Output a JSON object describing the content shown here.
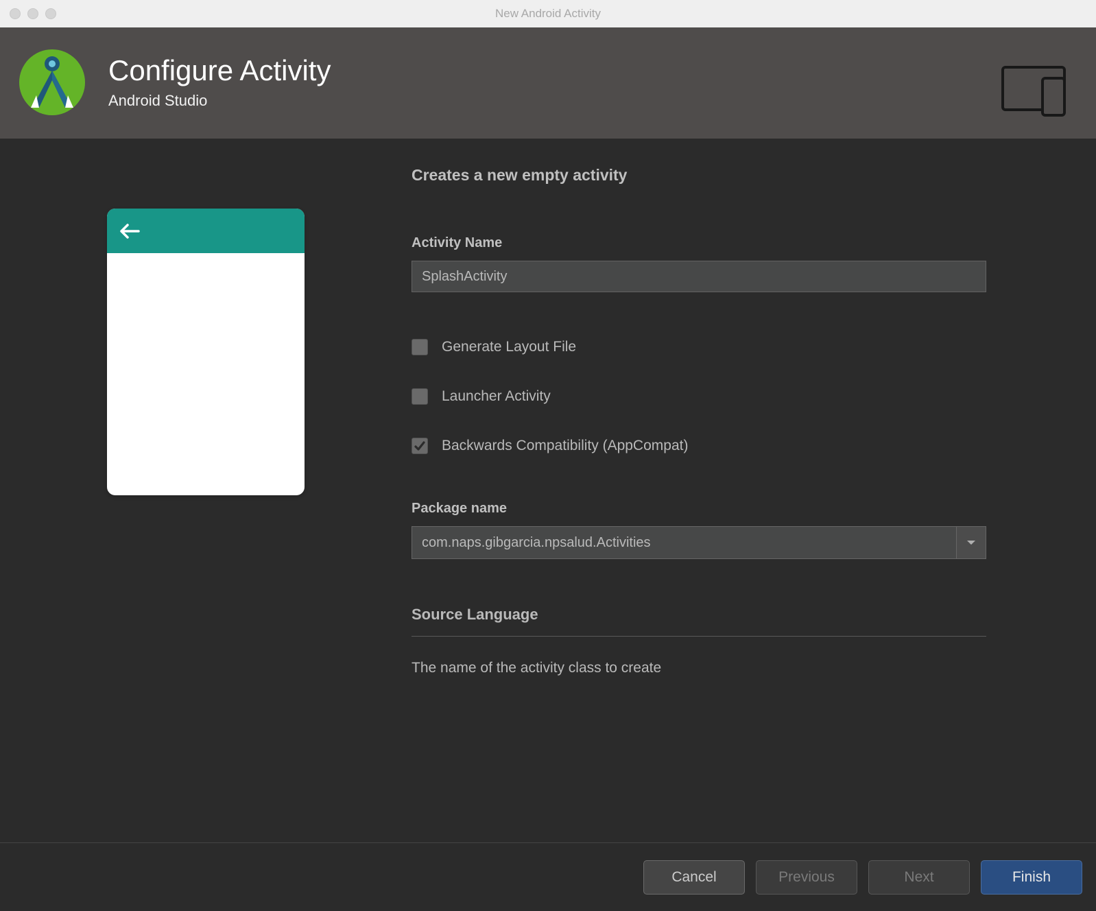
{
  "window": {
    "title": "New Android Activity"
  },
  "header": {
    "title": "Configure Activity",
    "subtitle": "Android Studio"
  },
  "form": {
    "description": "Creates a new empty activity",
    "activityName": {
      "label": "Activity Name",
      "value": "SplashActivity"
    },
    "generateLayout": {
      "label": "Generate Layout File",
      "checked": false
    },
    "launcherActivity": {
      "label": "Launcher Activity",
      "checked": false
    },
    "backwardsCompat": {
      "label": "Backwards Compatibility (AppCompat)",
      "checked": true
    },
    "packageName": {
      "label": "Package name",
      "value": "com.naps.gibgarcia.npsalud.Activities"
    },
    "sourceLanguage": {
      "label": "Source Language"
    },
    "helper": "The name of the activity class to create"
  },
  "footer": {
    "cancel": "Cancel",
    "previous": "Previous",
    "next": "Next",
    "finish": "Finish"
  }
}
